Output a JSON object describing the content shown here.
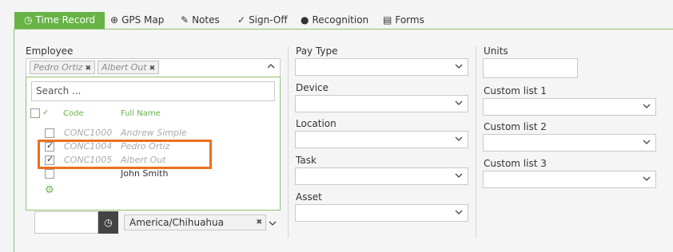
{
  "tabs": [
    {
      "label": "Time Record",
      "icon": "clock-icon",
      "active": true
    },
    {
      "label": "GPS Map",
      "icon": "globe-icon"
    },
    {
      "label": "Notes",
      "icon": "notes-icon"
    },
    {
      "label": "Sign-Off",
      "icon": "check-icon"
    },
    {
      "label": "Recognition",
      "icon": "user-icon"
    },
    {
      "label": "Forms",
      "icon": "form-icon"
    }
  ],
  "employee": {
    "label": "Employee",
    "selected_tags": [
      "Pedro Ortiz",
      "Albert Out"
    ],
    "dropdown": {
      "search_placeholder": "Search ...",
      "header_check": "✓",
      "col_code": "Code",
      "col_name": "Full Name",
      "rows": [
        {
          "code": "CONC1000",
          "name": "Andrew Simple",
          "checked": false
        },
        {
          "code": "CONC1004",
          "name": "Pedro Ortiz",
          "checked": true
        },
        {
          "code": "CONC1005",
          "name": "Albert Out",
          "checked": true
        },
        {
          "code": "",
          "name": "John Smith",
          "checked": false
        }
      ]
    }
  },
  "timezone": {
    "value": "America/Chihuahua"
  },
  "middle_fields": [
    "Pay Type",
    "Device",
    "Location",
    "Task",
    "Asset"
  ],
  "right_fields": {
    "units_label": "Units",
    "custom_lists": [
      "Custom list 1",
      "Custom list 2",
      "Custom list 3"
    ]
  },
  "colors": {
    "accent": "#67b346",
    "highlight": "#ec6f1d"
  }
}
